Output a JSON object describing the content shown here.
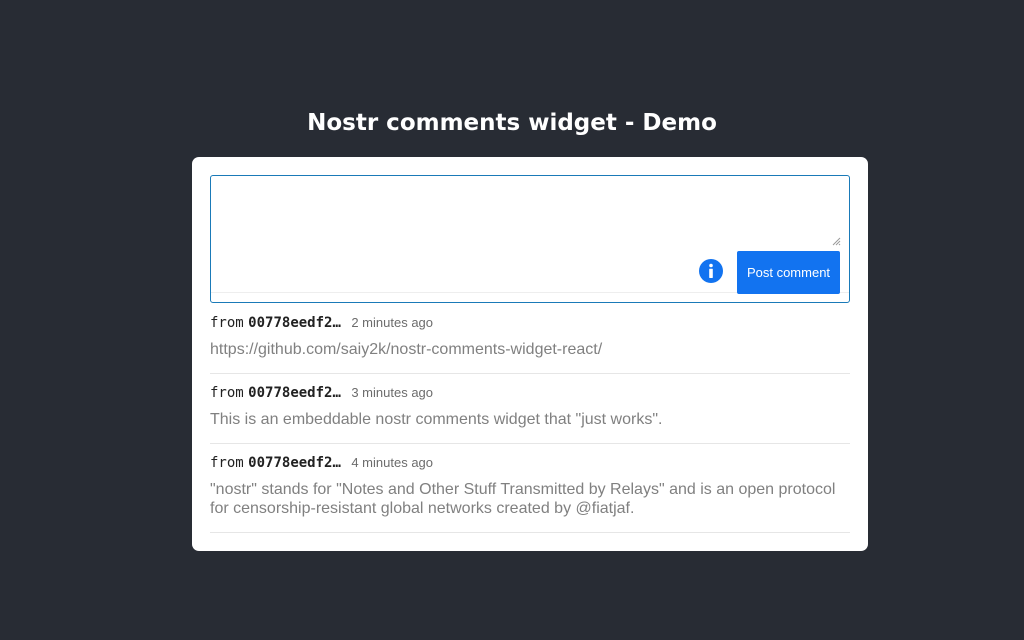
{
  "page": {
    "title": "Nostr comments widget - Demo"
  },
  "composer": {
    "input_value": "",
    "post_button_label": "Post comment",
    "info_icon": "info-circle-icon"
  },
  "comments": [
    {
      "from_label": "from",
      "author": "00778eedf2…",
      "time": "2 minutes ago",
      "body": "https://github.com/saiy2k/nostr-comments-widget-react/"
    },
    {
      "from_label": "from",
      "author": "00778eedf2…",
      "time": "3 minutes ago",
      "body": "This is an embeddable nostr comments widget that \"just works\"."
    },
    {
      "from_label": "from",
      "author": "00778eedf2…",
      "time": "4 minutes ago",
      "body": "\"nostr\" stands for \"Notes and Other Stuff Transmitted by Relays\" and is an open protocol for censorship-resistant global networks created by @fiatjaf."
    }
  ],
  "colors": {
    "background": "#282c34",
    "accent": "#1273f0",
    "input_border": "#1a7ab8"
  }
}
